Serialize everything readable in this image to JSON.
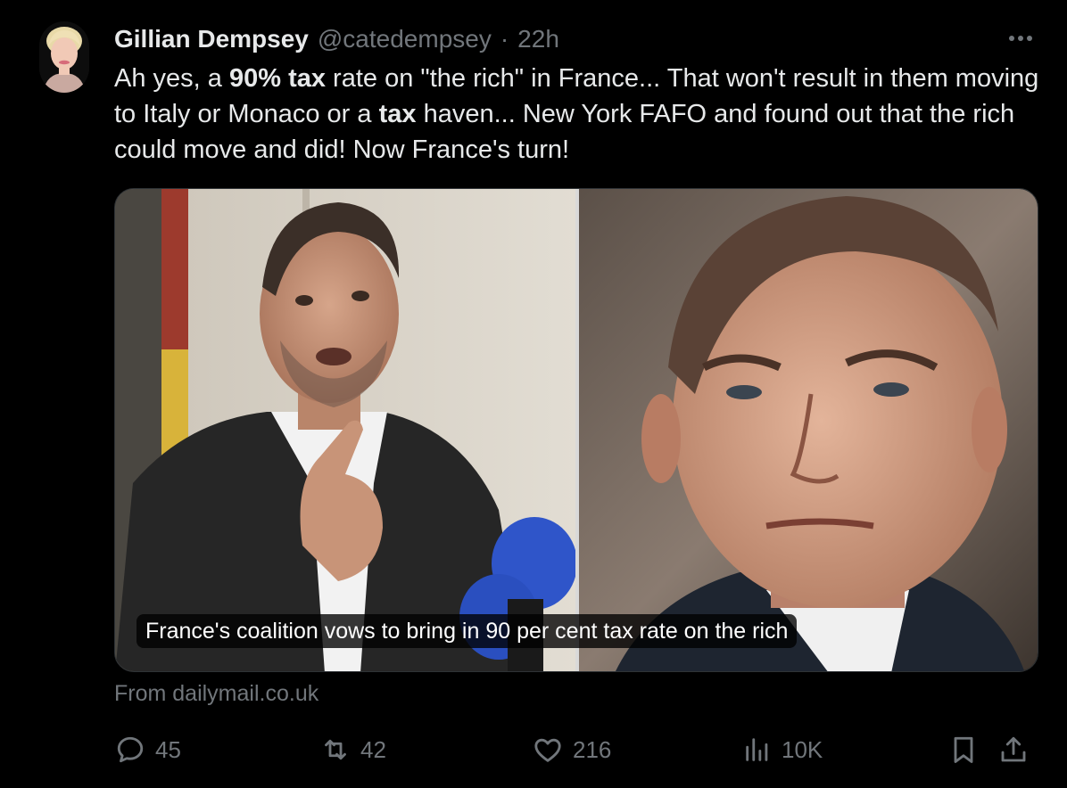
{
  "author": {
    "display_name": "Gillian Dempsey",
    "handle": "@catedempsey",
    "separator": "·",
    "time": "22h"
  },
  "menu_icon": "more-horizontal-icon",
  "body": {
    "t1": "Ah yes, a ",
    "b1": "90%",
    "t2": " ",
    "b2": "tax",
    "t3": " rate on \"the rich\" in France... That won't result in them moving to Italy or Monaco or a ",
    "b3": "tax",
    "t4": " haven... New York FAFO and found out that the rich could move and did! Now France's turn!"
  },
  "card": {
    "caption": "France's coalition vows to bring in 90 per cent tax rate on the rich",
    "source": "From dailymail.co.uk"
  },
  "actions": {
    "reply": {
      "icon": "reply-icon",
      "count": "45"
    },
    "repost": {
      "icon": "repost-icon",
      "count": "42"
    },
    "like": {
      "icon": "heart-icon",
      "count": "216"
    },
    "views": {
      "icon": "analytics-icon",
      "count": "10K"
    },
    "bookmark": {
      "icon": "bookmark-icon"
    },
    "share": {
      "icon": "share-icon"
    }
  },
  "colors": {
    "background": "#000000",
    "text": "#e7e9ea",
    "muted": "#71767b",
    "border": "#2f3336"
  }
}
